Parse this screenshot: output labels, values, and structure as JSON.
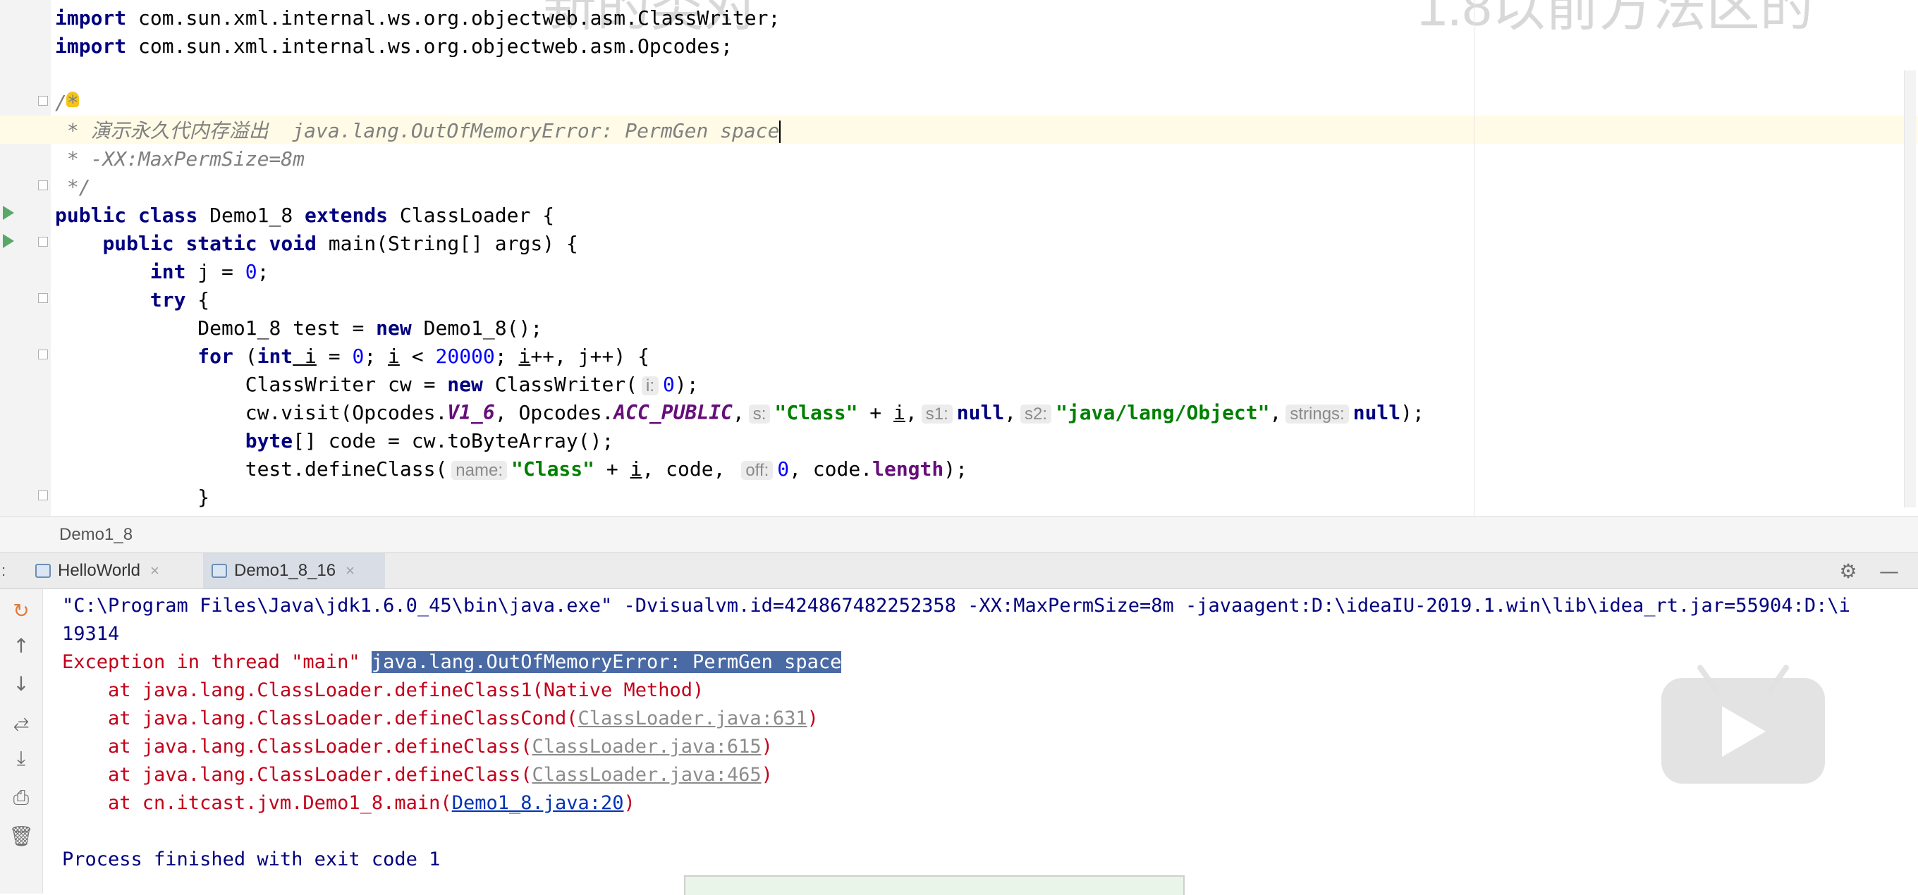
{
  "watermark": {
    "left": "新的类对",
    "right": "1.8以前方法区的"
  },
  "editor": {
    "lines": [
      {
        "t": "import com.sun.xml.internal.ws.org.objectweb.asm.ClassWriter;"
      },
      {
        "t": "import com.sun.xml.internal.ws.org.objectweb.asm.Opcodes;"
      },
      {
        "t": "/**"
      },
      {
        "t": " * 演示永久代内存溢出  java.lang.OutOfMemoryError: PermGen space"
      },
      {
        "t": " * -XX:MaxPermSize=8m"
      },
      {
        "t": " */"
      },
      {
        "t": "class Demo1_8 extends ClassLoader {"
      },
      {
        "t": "main(String[] args) {"
      },
      {
        "t": "0"
      },
      {
        "t": "try {"
      },
      {
        "t": "Demo1_8 test = new Demo1_8();"
      },
      {
        "t": "for"
      },
      {
        "t": "cw"
      },
      {
        "t": "cw.visit"
      },
      {
        "t": "byte[] code = cw.toByteArray();"
      },
      {
        "t": "test.defineClass("
      },
      {
        "t": "}"
      }
    ],
    "tokens": {
      "kw_import": "import",
      "import1": " com.sun.xml.internal.ws.org.objectweb.asm.ClassWriter;",
      "import2": " com.sun.xml.internal.ws.org.objectweb.asm.Opcodes;",
      "c_open": "/*",
      "c_line1": " * 演示永久代内存溢出  java.lang.OutOfMemoryError: PermGen space",
      "c_line2": " * -XX:MaxPermSize=8m",
      "c_close": " */",
      "kw_public": "public",
      "kw_class": "class",
      "classname": " Demo1_8 ",
      "kw_extends": "extends",
      "superclass": " ClassLoader {",
      "kw_static": "static",
      "kw_void": "void",
      "main_sig": " main(String[] args) {",
      "kw_int": "int",
      "j_decl": " j = ",
      "zero": "0",
      "semicolon": ";",
      "kw_try": "try",
      "brace_open": " {",
      "demo_decl": "Demo1_8 test = ",
      "kw_new": "new",
      "demo_ctor": " Demo1_8();",
      "kw_for": "for",
      "for_open": " (",
      "for_i": " i",
      "for_eq": " = ",
      "for_semi1": "; ",
      "for_i2": "i",
      "for_lt": " < ",
      "n20000": "20000",
      "for_semi2": "; ",
      "for_inc": "i",
      "for_rest": "++, j++) {",
      "cw_decl": "ClassWriter cw = ",
      "cw_ctor": " ClassWriter(",
      "hint_i": "i:",
      "cw_end": ");",
      "visit_start": "cw.visit(Opcodes.",
      "v1_6": "V1_6",
      "visit_op": ", Opcodes.",
      "acc_public": "ACC_PUBLIC",
      "comma": ",",
      "hint_s": "s:",
      "str_class": "\"Class\"",
      "plus": " + ",
      "var_i": "i",
      "hint_s1": "s1:",
      "kw_null": "null",
      "hint_s2": "s2:",
      "str_object": "\"java/lang/Object\"",
      "hint_strings": "strings:",
      "visit_end": ");",
      "kw_byte": "byte",
      "code_decl": "[] code = cw.toByteArray();",
      "define_start": "test.defineClass(",
      "hint_name": "name:",
      "code_arg": ", code, ",
      "hint_off": "off:",
      "length_pre": ", code.",
      "length": "length",
      "define_end": ");",
      "brace_close": "}"
    }
  },
  "breadcrumb": "Demo1_8",
  "run_tabs": [
    {
      "label": "HelloWorld",
      "close": "×"
    },
    {
      "label": "Demo1_8_16",
      "close": "×"
    }
  ],
  "console": {
    "cmd": "\"C:\\Program Files\\Java\\jdk1.6.0_45\\bin\\java.exe\" -Dvisualvm.id=424867482252358 -XX:MaxPermSize=8m -javaagent:D:\\ideaIU-2019.1.win\\lib\\idea_rt.jar=55904:D:\\i",
    "count": "19314",
    "exception_prefix": "Exception in thread \"main\" ",
    "exception_selected": "java.lang.OutOfMemoryError: PermGen space",
    "stack": [
      {
        "pre": "    at java.lang.ClassLoader.defineClass1(Native Method)",
        "link": "",
        "post": ""
      },
      {
        "pre": "    at java.lang.ClassLoader.defineClassCond(",
        "link": "ClassLoader.java:631",
        "post": ")"
      },
      {
        "pre": "    at java.lang.ClassLoader.defineClass(",
        "link": "ClassLoader.java:615",
        "post": ")"
      },
      {
        "pre": "    at java.lang.ClassLoader.defineClass(",
        "link": "ClassLoader.java:465",
        "post": ")"
      },
      {
        "pre": "    at cn.itcast.jvm.Demo1_8.main(",
        "link": "Demo1_8.java:20",
        "post": ")"
      }
    ],
    "finished": "Process finished with exit code 1"
  },
  "icons": [
    "run-icon",
    "bulb-icon",
    "fold-icon",
    "settings-icon",
    "minimize-icon",
    "rerun-icon",
    "up-arrow-icon",
    "down-arrow-icon",
    "soft-wrap-icon",
    "scroll-to-end-icon",
    "print-icon",
    "trash-icon",
    "play-icon"
  ],
  "colors": {
    "keyword": "#000080",
    "string": "#008000",
    "number": "#0000ff",
    "comment": "#808080",
    "field": "#660e7a",
    "error": "#c2001a",
    "selection": "#4a6aa5"
  }
}
